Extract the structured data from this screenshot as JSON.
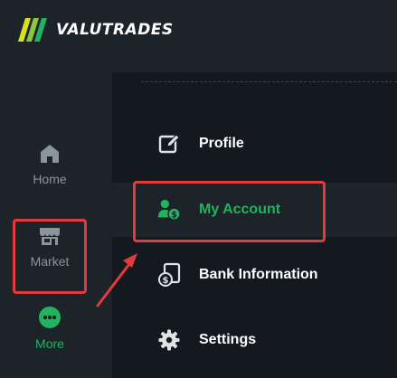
{
  "brand": {
    "name": "VALUTRADES",
    "stripe_colors": [
      "#d9e021",
      "#8cc63f",
      "#22b35e"
    ]
  },
  "sidebar": {
    "items": [
      {
        "label": "Home",
        "icon": "home-icon",
        "active": false
      },
      {
        "label": "Market",
        "icon": "store-icon",
        "active": false
      },
      {
        "label": "More",
        "icon": "more-dots-icon",
        "active": true
      }
    ]
  },
  "menu": {
    "items": [
      {
        "label": "Profile",
        "icon": "edit-profile-icon",
        "highlighted": false
      },
      {
        "label": "My Account",
        "icon": "user-dollar-icon",
        "highlighted": true
      },
      {
        "label": "Bank Information",
        "icon": "bank-document-icon",
        "highlighted": false
      },
      {
        "label": "Settings",
        "icon": "gear-icon",
        "highlighted": false
      }
    ]
  },
  "colors": {
    "accent_green": "#22b35e",
    "annotation_red": "#e23b3b",
    "sidebar_bg": "#1c2329",
    "content_bg": "#13191e",
    "muted_text": "#8c949c"
  }
}
